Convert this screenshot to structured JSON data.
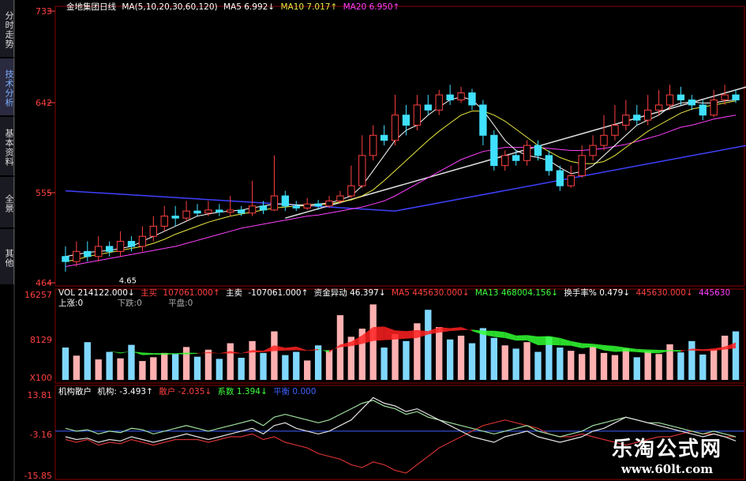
{
  "sidebar": {
    "tabs": [
      {
        "label": "分时走势",
        "active": false
      },
      {
        "label": "技术分析",
        "active": true
      },
      {
        "label": "基本资料",
        "active": false
      },
      {
        "label": "全景",
        "active": false
      },
      {
        "label": "其他",
        "active": false
      }
    ]
  },
  "main_header": {
    "stock": "金地集团日线",
    "ma_def": "MA(5,10,20,30,60,120)",
    "ma5": "MA5 6.992↓",
    "ma10": "MA10 7.017↑",
    "ma20": "MA20 6.950↑"
  },
  "price_axis": {
    "labels": [
      "733",
      "642",
      "555",
      "464"
    ],
    "low_mark": "4.65"
  },
  "vol_header": {
    "vol": "VOL 214122.000↓",
    "zhumai_lbl": "主买",
    "zhumai": "107061.000↑",
    "zhumai2_lbl": "主卖",
    "zhumai2": "-107061.000↑",
    "zijin": "资金异动 46.397↓",
    "ma5": "MA5 445630.000↓",
    "ma13": "MA13 468004.156↓",
    "huanshou": "换手率% 0.479↓",
    "v1": "445630.000↓",
    "v2": "445630"
  },
  "vol_sub": {
    "up": "上涨:0",
    "down": "下跌:0",
    "flat": "平盘:0"
  },
  "vol_axis": {
    "labels": [
      "16257",
      "8129",
      "X100"
    ]
  },
  "ind_header": {
    "name": "机构散户",
    "jigou": "机构: -3.493↑",
    "sanhu": "散户 -2.035↓",
    "xishu": "系数 1.394↓",
    "pingheng": "平衡 0.000"
  },
  "ind_axis": {
    "labels": [
      "13.81",
      "-3.16",
      "-15.85"
    ]
  },
  "watermark": {
    "title": "乐淘公式网",
    "url": "www.60lt.com"
  },
  "colors": {
    "up": "#ff4040",
    "down": "#40e0ff",
    "ma5": "#ffffff",
    "ma10": "#e8e840",
    "ma20": "#ff40ff",
    "ma60": "#40ff40",
    "ma120": "#4040ff",
    "grid": "#8b0000"
  },
  "chart_data": [
    {
      "type": "candlestick",
      "ylim": [
        4.64,
        7.33
      ],
      "candles": [
        [
          4.9,
          4.85,
          5.0,
          4.75
        ],
        [
          4.85,
          4.95,
          5.05,
          4.8
        ],
        [
          4.95,
          4.9,
          5.05,
          4.85
        ],
        [
          4.9,
          5.0,
          5.1,
          4.85
        ],
        [
          5.0,
          4.95,
          5.05,
          4.9
        ],
        [
          4.95,
          5.05,
          5.15,
          4.9
        ],
        [
          5.05,
          5.0,
          5.1,
          4.95
        ],
        [
          5.0,
          5.1,
          5.2,
          4.95
        ],
        [
          5.1,
          5.2,
          5.3,
          5.05
        ],
        [
          5.2,
          5.3,
          5.4,
          5.15
        ],
        [
          5.3,
          5.28,
          5.4,
          5.2
        ],
        [
          5.28,
          5.35,
          5.45,
          5.25
        ],
        [
          5.35,
          5.33,
          5.42,
          5.3
        ],
        [
          5.33,
          5.36,
          5.45,
          5.3
        ],
        [
          5.36,
          5.34,
          5.42,
          5.3
        ],
        [
          5.34,
          5.36,
          5.5,
          5.3
        ],
        [
          5.36,
          5.33,
          5.4,
          5.3
        ],
        [
          5.33,
          5.4,
          5.65,
          5.3
        ],
        [
          5.4,
          5.36,
          5.45,
          5.32
        ],
        [
          5.36,
          5.5,
          5.9,
          5.35
        ],
        [
          5.5,
          5.4,
          5.55,
          5.35
        ],
        [
          5.4,
          5.38,
          5.45,
          5.35
        ],
        [
          5.38,
          5.42,
          5.48,
          5.36
        ],
        [
          5.42,
          5.4,
          5.46,
          5.36
        ],
        [
          5.4,
          5.45,
          5.5,
          5.38
        ],
        [
          5.45,
          5.5,
          5.55,
          5.42
        ],
        [
          5.5,
          5.6,
          5.8,
          5.48
        ],
        [
          5.6,
          5.9,
          6.1,
          5.58
        ],
        [
          5.9,
          6.1,
          6.2,
          5.85
        ],
        [
          6.1,
          6.05,
          6.2,
          6.0
        ],
        [
          6.05,
          6.3,
          6.5,
          6.0
        ],
        [
          6.3,
          6.2,
          6.4,
          6.1
        ],
        [
          6.2,
          6.4,
          6.5,
          6.15
        ],
        [
          6.4,
          6.35,
          6.5,
          6.3
        ],
        [
          6.35,
          6.5,
          6.55,
          6.3
        ],
        [
          6.5,
          6.45,
          6.6,
          6.4
        ],
        [
          6.45,
          6.52,
          6.58,
          6.42
        ],
        [
          6.52,
          6.4,
          6.56,
          6.35
        ],
        [
          6.4,
          6.1,
          6.45,
          6.0
        ],
        [
          6.1,
          5.8,
          6.15,
          5.75
        ],
        [
          5.8,
          5.9,
          5.95,
          5.75
        ],
        [
          5.9,
          5.85,
          5.95,
          5.8
        ],
        [
          5.85,
          6.0,
          6.05,
          5.8
        ],
        [
          6.0,
          5.9,
          6.05,
          5.85
        ],
        [
          5.9,
          5.75,
          5.95,
          5.7
        ],
        [
          5.75,
          5.6,
          5.8,
          5.55
        ],
        [
          5.6,
          5.7,
          5.8,
          5.58
        ],
        [
          5.7,
          5.9,
          6.0,
          5.68
        ],
        [
          5.9,
          6.0,
          6.1,
          5.85
        ],
        [
          6.0,
          6.1,
          6.3,
          5.95
        ],
        [
          6.1,
          6.2,
          6.4,
          6.05
        ],
        [
          6.2,
          6.3,
          6.45,
          6.15
        ],
        [
          6.3,
          6.25,
          6.4,
          6.2
        ],
        [
          6.25,
          6.35,
          6.5,
          6.2
        ],
        [
          6.35,
          6.4,
          6.55,
          6.3
        ],
        [
          6.4,
          6.5,
          6.6,
          6.35
        ],
        [
          6.5,
          6.45,
          6.58,
          6.4
        ],
        [
          6.45,
          6.4,
          6.5,
          6.35
        ],
        [
          6.4,
          6.3,
          6.45,
          6.25
        ],
        [
          6.3,
          6.45,
          6.55,
          6.28
        ],
        [
          6.45,
          6.5,
          6.6,
          6.4
        ],
        [
          6.5,
          6.45,
          6.55,
          6.42
        ]
      ],
      "ma5": [
        4.9,
        4.92,
        4.94,
        4.95,
        4.96,
        4.98,
        5.0,
        5.05,
        5.1,
        5.15,
        5.2,
        5.25,
        5.3,
        5.32,
        5.34,
        5.35,
        5.36,
        5.38,
        5.4,
        5.42,
        5.42,
        5.41,
        5.41,
        5.42,
        5.43,
        5.46,
        5.5,
        5.6,
        5.75,
        5.9,
        6.05,
        6.15,
        6.2,
        6.3,
        6.38,
        6.45,
        6.48,
        6.45,
        6.35,
        6.2,
        6.05,
        5.95,
        5.9,
        5.88,
        5.85,
        5.78,
        5.72,
        5.74,
        5.8,
        5.9,
        6.0,
        6.1,
        6.2,
        6.25,
        6.3,
        6.38,
        6.42,
        6.43,
        6.42,
        6.42,
        6.44,
        6.45
      ],
      "ma10": [
        4.85,
        4.87,
        4.9,
        4.92,
        4.94,
        4.96,
        4.98,
        5.0,
        5.03,
        5.07,
        5.12,
        5.16,
        5.2,
        5.24,
        5.27,
        5.3,
        5.32,
        5.34,
        5.36,
        5.38,
        5.39,
        5.4,
        5.4,
        5.41,
        5.42,
        5.44,
        5.46,
        5.5,
        5.56,
        5.65,
        5.75,
        5.85,
        5.95,
        6.05,
        6.14,
        6.22,
        6.3,
        6.34,
        6.34,
        6.3,
        6.24,
        6.16,
        6.08,
        6.0,
        5.94,
        5.88,
        5.84,
        5.82,
        5.82,
        5.84,
        5.9,
        5.98,
        6.06,
        6.14,
        6.2,
        6.26,
        6.32,
        6.36,
        6.38,
        6.4,
        6.42,
        6.44
      ],
      "ma20": [
        4.8,
        4.82,
        4.84,
        4.86,
        4.88,
        4.9,
        4.92,
        4.94,
        4.96,
        4.98,
        5.0,
        5.03,
        5.06,
        5.09,
        5.12,
        5.15,
        5.18,
        5.2,
        5.22,
        5.24,
        5.26,
        5.28,
        5.3,
        5.31,
        5.33,
        5.35,
        5.37,
        5.39,
        5.42,
        5.45,
        5.5,
        5.56,
        5.62,
        5.68,
        5.74,
        5.8,
        5.86,
        5.9,
        5.94,
        5.96,
        5.98,
        5.98,
        5.98,
        5.98,
        5.97,
        5.96,
        5.95,
        5.95,
        5.96,
        5.97,
        5.99,
        6.01,
        6.04,
        6.07,
        6.1,
        6.14,
        6.18,
        6.2,
        6.23,
        6.26,
        6.28,
        6.3
      ],
      "ma60_xy": [
        [
          20,
          5.28
        ],
        [
          62,
          6.58
        ]
      ],
      "ma120_xy": [
        [
          0,
          5.55
        ],
        [
          30,
          5.35
        ],
        [
          62,
          6.0
        ]
      ]
    },
    {
      "type": "bar",
      "ylim": [
        0,
        16257
      ],
      "volumes": [
        6000,
        4500,
        7000,
        3800,
        5200,
        4000,
        6500,
        3500,
        4200,
        5000,
        4800,
        6100,
        4300,
        5600,
        3900,
        6800,
        4100,
        7200,
        5000,
        9000,
        4600,
        5200,
        3600,
        6400,
        5500,
        12000,
        8000,
        9500,
        14000,
        6000,
        8500,
        7200,
        10500,
        13000,
        9800,
        7500,
        8200,
        6800,
        9600,
        7800,
        6400,
        5800,
        7000,
        5200,
        8000,
        6000,
        5400,
        4800,
        6200,
        5000,
        4600,
        5800,
        4200,
        5300,
        4800,
        6600,
        5100,
        7200,
        4700,
        5600,
        8200,
        9000
      ]
    },
    {
      "type": "line",
      "ylim": [
        -15.85,
        13.81
      ],
      "jigou": [
        -2,
        -3,
        -2.5,
        -4,
        -3,
        -3.5,
        -2,
        -3,
        -4,
        -3,
        -2,
        -1,
        -2,
        -3,
        -2,
        -1,
        0,
        1,
        -1,
        2,
        3,
        1,
        0,
        -1,
        0,
        2,
        4,
        8,
        12,
        10,
        9,
        7,
        8,
        6,
        4,
        2,
        0,
        -2,
        -3,
        -4,
        -2,
        -1,
        0,
        -2,
        -3,
        -4,
        -3,
        -2,
        0,
        1,
        3,
        5,
        4,
        3,
        2,
        1,
        0,
        -1,
        -2,
        -1,
        -2,
        -3.5
      ],
      "sanhu": [
        -3,
        -4,
        -3,
        -5,
        -4,
        -4.5,
        -3,
        -4,
        -5,
        -4,
        -3,
        -3,
        -3,
        -4,
        -3,
        -2,
        -2,
        -1,
        -3,
        -2,
        -4,
        -5,
        -6,
        -8,
        -9,
        -10,
        -12,
        -13,
        -11,
        -12,
        -14,
        -15,
        -12,
        -9,
        -6,
        -4,
        -2,
        0,
        2,
        3,
        4,
        3,
        2,
        1,
        -1,
        -2,
        -2,
        -1,
        -2,
        -3,
        -4,
        -5,
        -4,
        -3,
        -2,
        -2,
        -1,
        0,
        -1,
        -1,
        -2,
        -2
      ],
      "xishu": [
        1,
        0,
        0.5,
        -1,
        0,
        -0.5,
        1,
        0.5,
        -1,
        0,
        1,
        2,
        1,
        0,
        1,
        2,
        3,
        4,
        2,
        5,
        6,
        5,
        4,
        3,
        4,
        6,
        8,
        10,
        11,
        9,
        8,
        6,
        7,
        5,
        4,
        3,
        2,
        1,
        0,
        -1,
        0,
        1,
        2,
        0,
        -1,
        -2,
        -1,
        0,
        2,
        3,
        4,
        5,
        4,
        3,
        3,
        2,
        1,
        0,
        -1,
        0,
        -1,
        -2
      ]
    }
  ]
}
